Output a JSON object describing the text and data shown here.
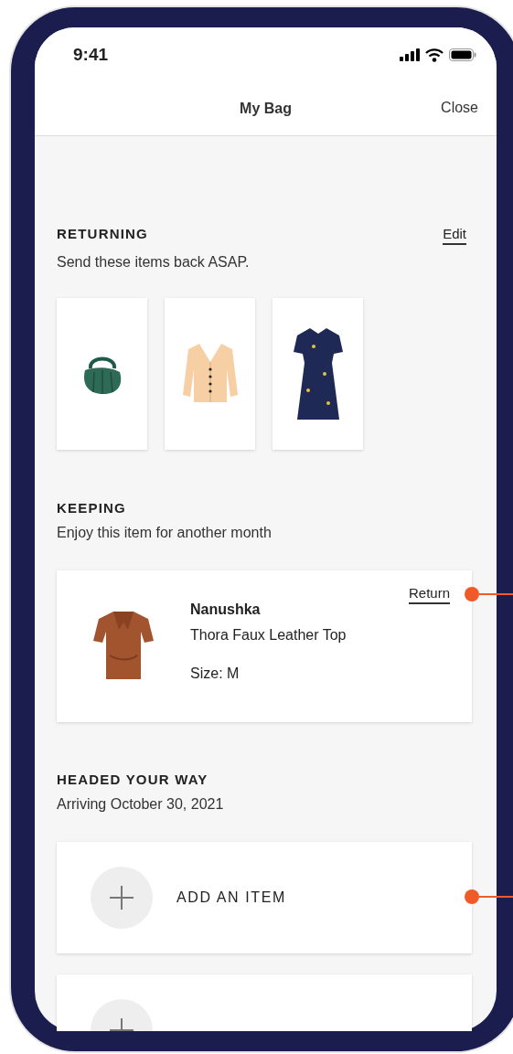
{
  "status_bar": {
    "time": "9:41"
  },
  "nav": {
    "title": "My Bag",
    "close": "Close"
  },
  "returning": {
    "heading": "RETURNING",
    "action": "Edit",
    "subtitle": "Send these items back ASAP.",
    "items": [
      {
        "kind": "bag"
      },
      {
        "kind": "cardigan"
      },
      {
        "kind": "dress"
      }
    ]
  },
  "keeping": {
    "heading": "KEEPING",
    "subtitle": "Enjoy this item for another month",
    "item": {
      "kind": "top",
      "brand": "Nanushka",
      "name": "Thora Faux Leather Top",
      "size": "Size: M",
      "action": "Return",
      "annotated": true
    }
  },
  "headed": {
    "heading": "HEADED YOUR WAY",
    "subtitle": "Arriving October 30, 2021",
    "slots": [
      {
        "kind": "add",
        "label": "ADD AN ITEM",
        "annotated": true
      },
      {
        "kind": "add"
      }
    ]
  }
}
